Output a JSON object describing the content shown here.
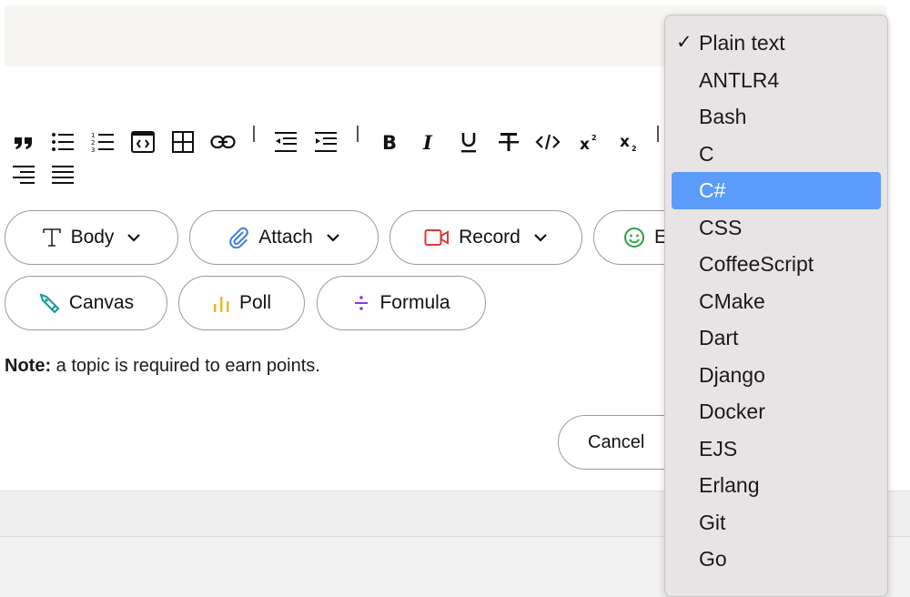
{
  "toolbar": {
    "icons": [
      "quote-icon",
      "bullet-list-icon",
      "numbered-list-icon",
      "code-block-icon",
      "table-icon",
      "link-icon",
      "outdent-icon",
      "indent-icon",
      "bold-icon",
      "italic-icon",
      "underline-icon",
      "strikethrough-icon",
      "inline-code-icon",
      "superscript-icon",
      "subscript-icon",
      "align-right-icon",
      "justify-icon"
    ]
  },
  "buttons": {
    "body": "Body",
    "attach": "Attach",
    "record": "Record",
    "emoji": "E",
    "canvas": "Canvas",
    "poll": "Poll",
    "formula": "Formula",
    "cancel": "Cancel"
  },
  "colors": {
    "attach": "#3b7be0",
    "record": "#e03a3a",
    "emoji": "#2ea043",
    "canvas": "#139a9a",
    "poll": "#f0b429",
    "formula": "#8a3ad8",
    "selected": "#5a9cf8"
  },
  "note": {
    "label": "Note:",
    "text": " a topic is required to earn points."
  },
  "dropdown": {
    "check": "✓",
    "items": [
      "Plain text",
      "ANTLR4",
      "Bash",
      "C",
      "C#",
      "CSS",
      "CoffeeScript",
      "CMake",
      "Dart",
      "Django",
      "Docker",
      "EJS",
      "Erlang",
      "Git",
      "Go"
    ],
    "checked": "Plain text",
    "highlighted": "C#"
  }
}
